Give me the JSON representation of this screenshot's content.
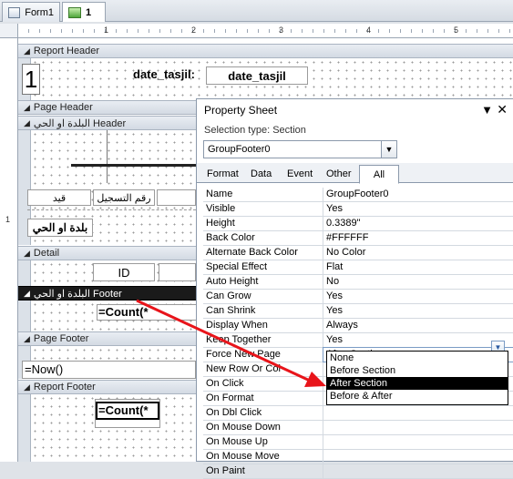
{
  "tabs": [
    {
      "label": "Form1",
      "icon": "form-icon"
    },
    {
      "label": "1",
      "icon": "report-icon"
    }
  ],
  "ruler": {
    "marks": [
      "1",
      "2",
      "3",
      "4",
      "5"
    ],
    "vmark": "1"
  },
  "sections": {
    "report_header": "Report Header",
    "page_header": "Page Header",
    "group_header": "البلدة او الحي  Header",
    "detail": "Detail",
    "group_footer": "البلدة او الحي  Footer",
    "page_footer": "Page Footer",
    "report_footer": "Report Footer"
  },
  "controls": {
    "header_number": "1",
    "date_label": "date_tasjil:",
    "date_field": "date_tasjil",
    "col_label_1": "قيد",
    "col_label_2": "رقم التسجيل",
    "group_field": "بلدة او الحي",
    "id_field": "ID",
    "footer_count": "=Count(*",
    "page_footer_now": "=Now()",
    "report_count": "=Count(*"
  },
  "property_sheet": {
    "title": "Property Sheet",
    "selection_type_label": "Selection type:  Section",
    "selected_object": "GroupFooter0",
    "tabs": [
      "Format",
      "Data",
      "Event",
      "Other",
      "All"
    ],
    "active_tab": "All",
    "properties": [
      {
        "name": "Name",
        "value": "GroupFooter0"
      },
      {
        "name": "Visible",
        "value": "Yes"
      },
      {
        "name": "Height",
        "value": "0.3389\""
      },
      {
        "name": "Back Color",
        "value": "#FFFFFF"
      },
      {
        "name": "Alternate Back Color",
        "value": "No Color"
      },
      {
        "name": "Special Effect",
        "value": "Flat"
      },
      {
        "name": "Auto Height",
        "value": "No"
      },
      {
        "name": "Can Grow",
        "value": "Yes"
      },
      {
        "name": "Can Shrink",
        "value": "Yes"
      },
      {
        "name": "Display When",
        "value": "Always"
      },
      {
        "name": "Keep Together",
        "value": "Yes"
      },
      {
        "name": "Force New Page",
        "value": "After Section"
      },
      {
        "name": "New Row Or Col",
        "value": ""
      },
      {
        "name": "On Click",
        "value": ""
      },
      {
        "name": "On Format",
        "value": ""
      },
      {
        "name": "On Dbl Click",
        "value": ""
      },
      {
        "name": "On Mouse Down",
        "value": ""
      },
      {
        "name": "On Mouse Up",
        "value": ""
      },
      {
        "name": "On Mouse Move",
        "value": ""
      },
      {
        "name": "On Paint",
        "value": ""
      }
    ],
    "dropdown_options": [
      "None",
      "Before Section",
      "After Section",
      "Before & After"
    ],
    "dropdown_selected": "After Section"
  },
  "colors": {
    "arrow": "#e8141a",
    "selected_bar": "#1a1a1a"
  }
}
